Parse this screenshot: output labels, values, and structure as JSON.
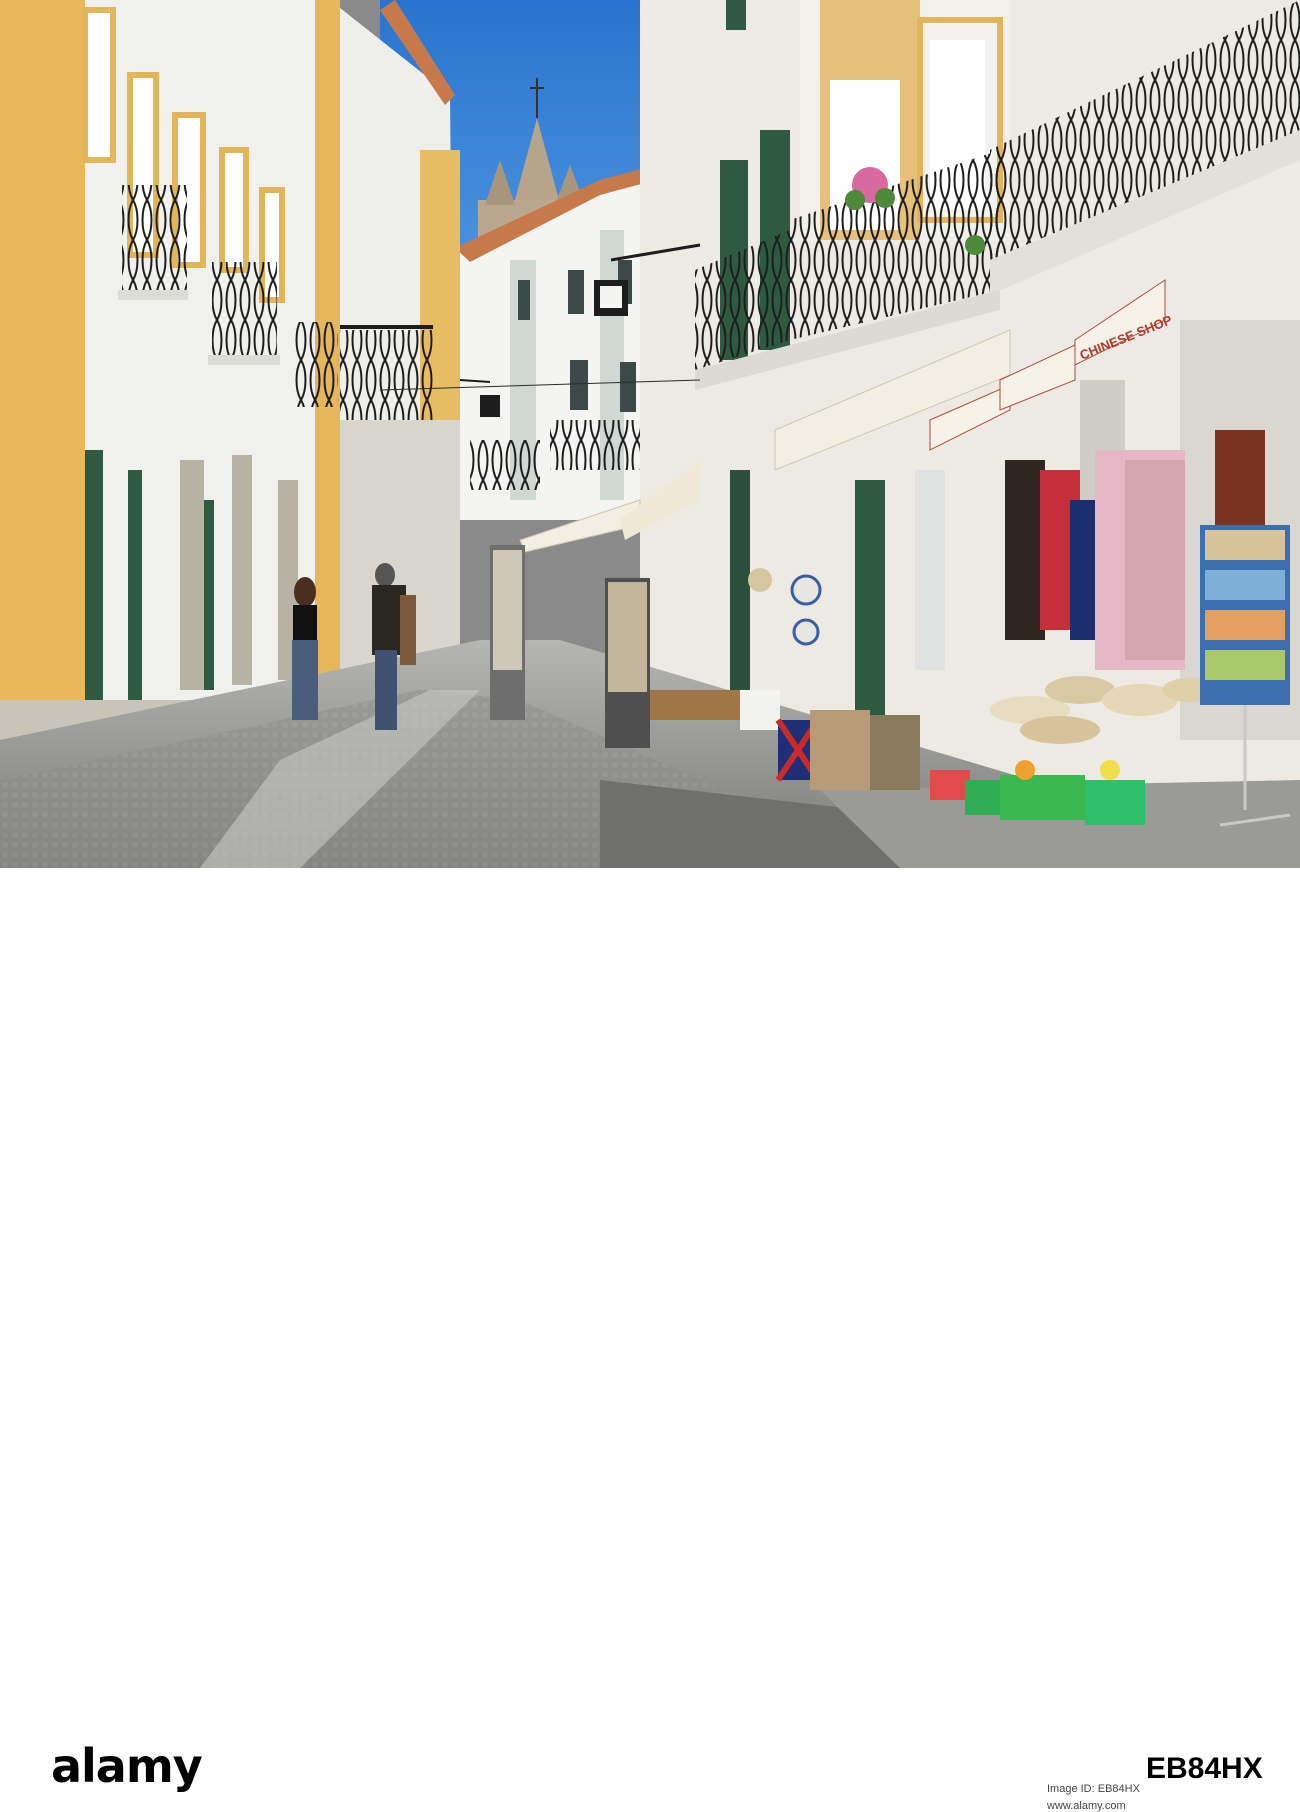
{
  "photo": {
    "shop_signs": [
      "CHINESE SHOP"
    ],
    "colors": {
      "sky": "#2f7fd6",
      "wall_white": "#f2f2ee",
      "trim_yellow": "#e8b85a",
      "iron": "#1d1d1d",
      "green_door": "#2e5a40",
      "cobble": "#8f8f8f",
      "awning": "#f3eee2"
    }
  },
  "footer": {
    "logo": "alamy",
    "image_id_label": "Image ID: EB84HX",
    "image_id": "EB84HX",
    "url": "www.alamy.com"
  }
}
